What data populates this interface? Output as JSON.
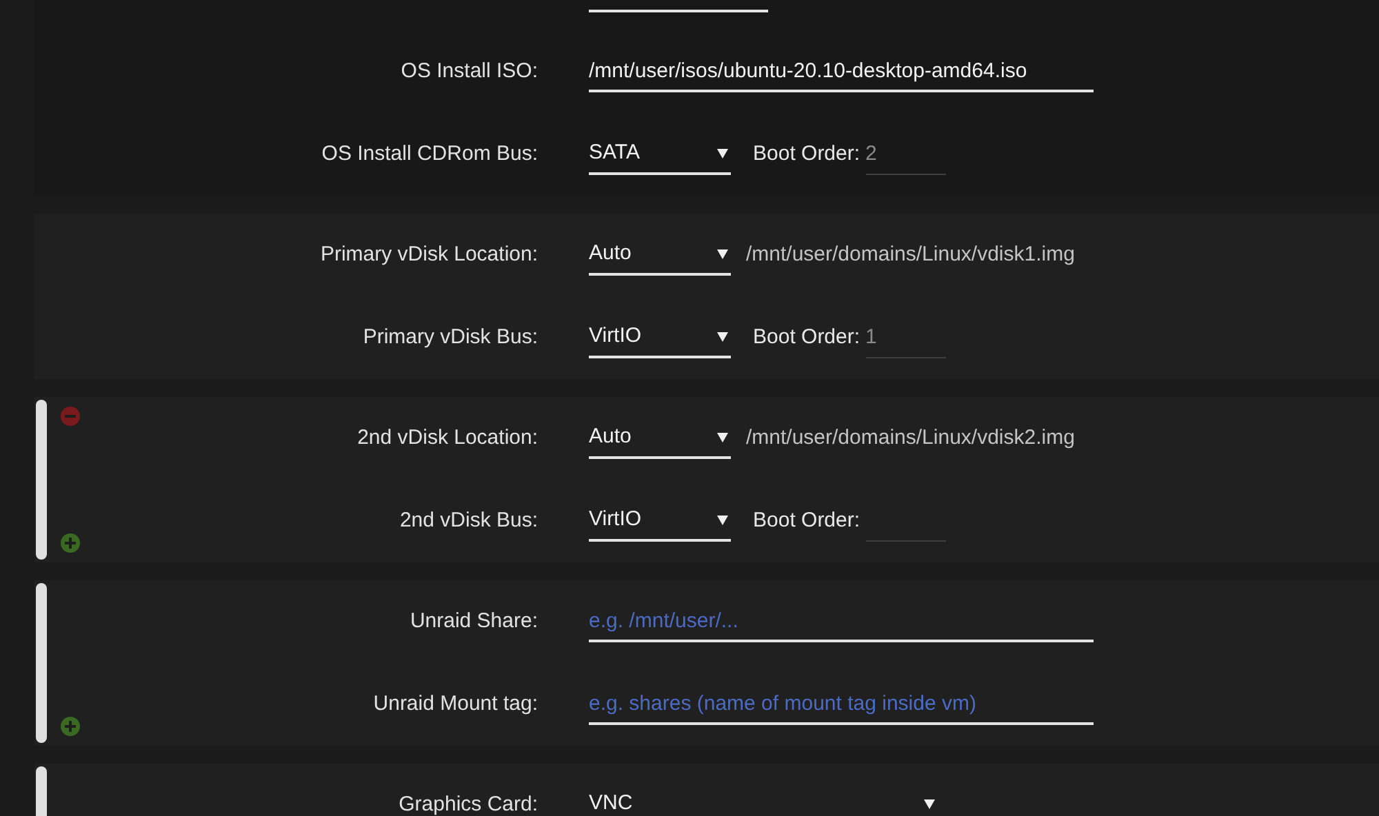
{
  "sections": [
    {
      "handle": false,
      "remove_button": false,
      "add_button": false,
      "cut_field_above": true,
      "rows": [
        {
          "kind": "text",
          "label": "OS Install ISO:",
          "value": "/mnt/user/isos/ubuntu-20.10-desktop-amd64.iso"
        },
        {
          "kind": "select",
          "label": "OS Install CDRom Bus:",
          "value": "SATA",
          "boot_order": {
            "label": "Boot Order:",
            "value": "2"
          }
        }
      ]
    },
    {
      "handle": false,
      "remove_button": false,
      "add_button": false,
      "cut_field_above": false,
      "rows": [
        {
          "kind": "select",
          "label": "Primary vDisk Location:",
          "value": "Auto",
          "path": "/mnt/user/domains/Linux/vdisk1.img"
        },
        {
          "kind": "select",
          "label": "Primary vDisk Bus:",
          "value": "VirtIO",
          "boot_order": {
            "label": "Boot Order:",
            "value": "1"
          }
        }
      ]
    },
    {
      "handle": true,
      "remove_button": true,
      "add_button": true,
      "cut_field_above": false,
      "rows": [
        {
          "kind": "select",
          "label": "2nd vDisk Location:",
          "value": "Auto",
          "path": "/mnt/user/domains/Linux/vdisk2.img"
        },
        {
          "kind": "select",
          "label": "2nd vDisk Bus:",
          "value": "VirtIO",
          "boot_order": {
            "label": "Boot Order:"
          }
        }
      ]
    },
    {
      "handle": true,
      "remove_button": false,
      "add_button": true,
      "cut_field_above": false,
      "rows": [
        {
          "kind": "text",
          "label": "Unraid Share:",
          "placeholder": "e.g. /mnt/user/..."
        },
        {
          "kind": "text",
          "label": "Unraid Mount tag:",
          "placeholder": "e.g. shares (name of mount tag inside vm)"
        }
      ]
    },
    {
      "handle": true,
      "remove_button": false,
      "add_button": false,
      "cut_field_above": false,
      "rows": [
        {
          "kind": "wide-select",
          "label": "Graphics Card:",
          "value": "VNC"
        }
      ]
    }
  ]
}
